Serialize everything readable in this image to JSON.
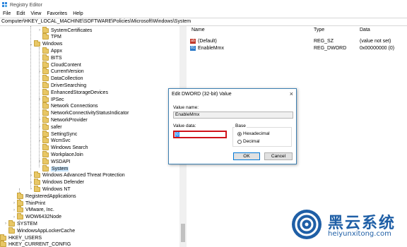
{
  "window": {
    "title": "Registry Editor"
  },
  "menu": [
    "File",
    "Edit",
    "View",
    "Favorites",
    "Help"
  ],
  "address": "Computer\\HKEY_LOCAL_MACHINE\\SOFTWARE\\Policies\\Microsoft\\Windows\\System",
  "tree": [
    {
      "label": "SystemCertificates",
      "expander": ">"
    },
    {
      "label": "TPM",
      "expander": ""
    },
    {
      "label": "Windows",
      "expander": "v"
    },
    {
      "label": "Appx",
      "expander": ""
    },
    {
      "label": "BITS",
      "expander": ""
    },
    {
      "label": "CloudContent",
      "expander": ""
    },
    {
      "label": "CurrentVersion",
      "expander": ">"
    },
    {
      "label": "DataCollection",
      "expander": ""
    },
    {
      "label": "DriverSearching",
      "expander": ""
    },
    {
      "label": "EnhancedStorageDevices",
      "expander": ""
    },
    {
      "label": "IPSec",
      "expander": ">"
    },
    {
      "label": "Network Connections",
      "expander": ""
    },
    {
      "label": "NetworkConnectivityStatusIndicator",
      "expander": ""
    },
    {
      "label": "NetworkProvider",
      "expander": ">"
    },
    {
      "label": "safer",
      "expander": ">"
    },
    {
      "label": "SettingSync",
      "expander": ""
    },
    {
      "label": "WcmSvc",
      "expander": ">"
    },
    {
      "label": "Windows Search",
      "expander": ""
    },
    {
      "label": "WorkplaceJoin",
      "expander": ""
    },
    {
      "label": "WSDAPI",
      "expander": ">"
    },
    {
      "label": "System",
      "expander": "",
      "selected": true
    },
    {
      "label": "Windows Advanced Threat Protection",
      "expander": ">"
    },
    {
      "label": "Windows Defender",
      "expander": ">"
    },
    {
      "label": "Windows NT",
      "expander": ">"
    },
    {
      "label": "RegisteredApplications",
      "expander": ""
    },
    {
      "label": "ThinPrint",
      "expander": ">"
    },
    {
      "label": "VMware, Inc.",
      "expander": ">"
    },
    {
      "label": "WOW6432Node",
      "expander": ">"
    },
    {
      "label": "SYSTEM",
      "expander": ">"
    },
    {
      "label": "WindowsAppLockerCache",
      "expander": ""
    },
    {
      "label": "HKEY_USERS",
      "expander": ">"
    },
    {
      "label": "HKEY_CURRENT_CONFIG",
      "expander": ">"
    }
  ],
  "list": {
    "headers": {
      "name": "Name",
      "type": "Type",
      "data": "Data"
    },
    "rows": [
      {
        "icon": "string-value-icon",
        "name": "(Default)",
        "type": "REG_SZ",
        "data": "(value not set)"
      },
      {
        "icon": "dword-value-icon",
        "name": "EnableMmx",
        "type": "REG_DWORD",
        "data": "0x00000000 (0)"
      }
    ]
  },
  "dialog": {
    "title": "Edit DWORD (32-bit) Value",
    "close": "×",
    "value_name_label": "Value name:",
    "value_name": "EnableMmx",
    "value_data_label": "Value data:",
    "value_data": "0",
    "base_label": "Base",
    "hex_label": "Hexadecimal",
    "dec_label": "Decimal",
    "base_selected": "Hexadecimal",
    "ok_label": "OK",
    "cancel_label": "Cancel"
  },
  "watermark": {
    "title": "黑云系统",
    "url": "heiyunxitong.com"
  },
  "colors": {
    "folder": "#e8c766",
    "highlight": "#d0121a",
    "selection": "#cce8ff",
    "brand": "#1f5fa6"
  }
}
